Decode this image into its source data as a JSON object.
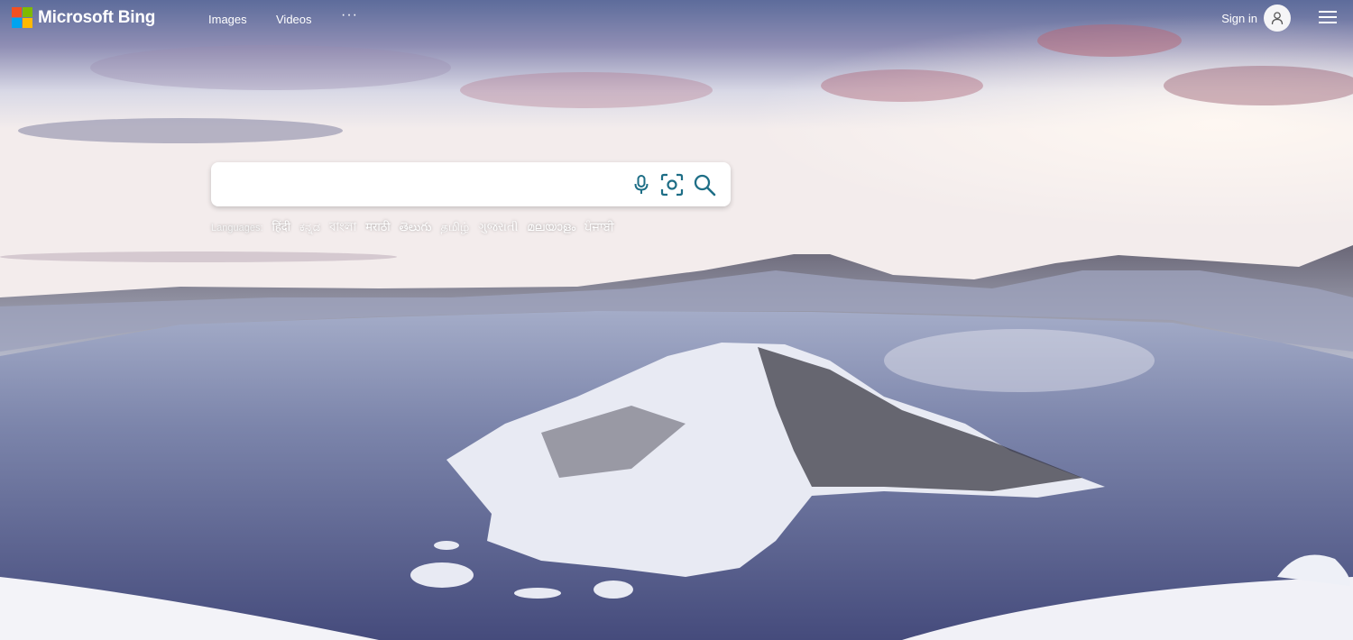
{
  "header": {
    "logo_text": "Microsoft Bing",
    "logo_colors": [
      "#f25022",
      "#7fba00",
      "#00a4ef",
      "#ffb900"
    ],
    "nav": [
      {
        "label": "Images"
      },
      {
        "label": "Videos"
      },
      {
        "label": "···"
      }
    ],
    "signin_label": "Sign in",
    "icons": {
      "avatar": "user-icon",
      "menu": "hamburger-menu-icon"
    }
  },
  "search": {
    "value": "",
    "placeholder": "",
    "icons": [
      "microphone-icon",
      "visual-search-icon",
      "search-icon"
    ],
    "accent_color": "#1e6e86"
  },
  "languages": {
    "label": "Languages:",
    "items": [
      "हिंदी",
      "ಕನ್ನಡ",
      "বাংলা",
      "मराठी",
      "తెలుగు",
      "தமிழ்",
      "ગુજરાતી",
      "മലയാളം",
      "ਪੰਜਾਬੀ"
    ]
  }
}
